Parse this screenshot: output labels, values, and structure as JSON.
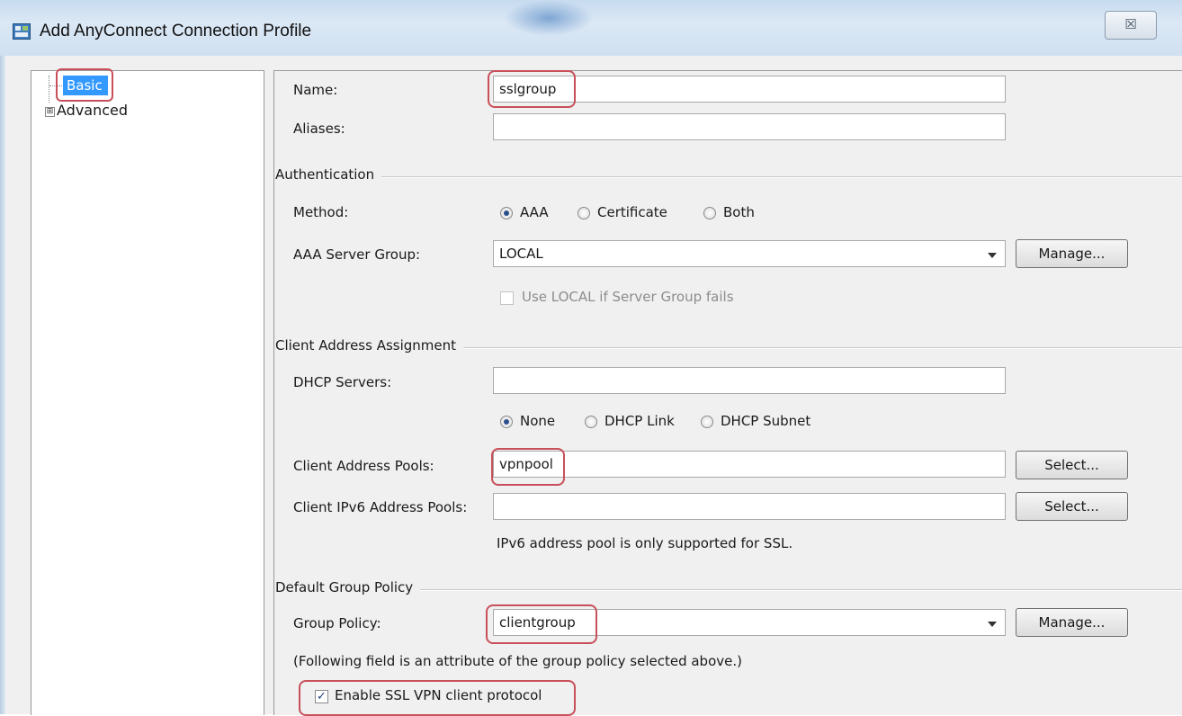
{
  "window": {
    "title": "Add AnyConnect Connection Profile",
    "close_symbol": "☒",
    "accent_color": "#3399ff",
    "highlight_color": "#c8505a"
  },
  "tree": {
    "items": [
      {
        "label": "Basic",
        "selected": true
      },
      {
        "label": "Advanced",
        "expander": "⊞"
      }
    ]
  },
  "form": {
    "name_label": "Name:",
    "name_value": "sslgroup",
    "aliases_label": "Aliases:",
    "aliases_value": "",
    "auth_section": "Authentication",
    "method_label": "Method:",
    "method_options": [
      "AAA",
      "Certificate",
      "Both"
    ],
    "method_selected": "AAA",
    "aaa_label": "AAA Server Group:",
    "aaa_value": "LOCAL",
    "manage_label": "Manage...",
    "use_local_label": "Use LOCAL if Server Group fails",
    "client_section": "Client Address Assignment",
    "dhcp_label": "DHCP Servers:",
    "dhcp_value": "",
    "dhcp_options": [
      "None",
      "DHCP Link",
      "DHCP Subnet"
    ],
    "dhcp_selected": "None",
    "pools_label": "Client Address Pools:",
    "pools_value": "vpnpool",
    "select_label": "Select...",
    "ipv6_label": "Client IPv6 Address Pools:",
    "ipv6_value": "",
    "ipv6_note": "IPv6 address pool is only supported for SSL.",
    "policy_section": "Default Group Policy",
    "policy_label": "Group Policy:",
    "policy_value": "clientgroup",
    "attribute_note": "(Following field is an attribute of the group policy selected above.)",
    "ssl_label": "Enable SSL VPN client protocol",
    "ssl_checked": true
  }
}
